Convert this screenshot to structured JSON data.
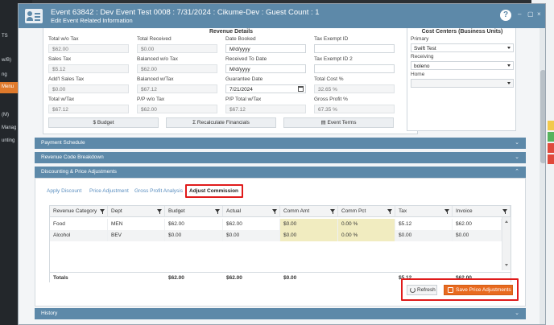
{
  "background": {
    "left_items": [
      "TS",
      "w/B)",
      "ng",
      "Menu",
      "(M)",
      "Manag",
      "unting"
    ],
    "menu_item": "Menu"
  },
  "header": {
    "title": "Event 63842 : Dev Event Test 0008 : 7/31/2024 : Cikume-Dev : Guest Count : 1",
    "subtitle": "Edit Event Related Information",
    "help_label": "?",
    "minimize": "–",
    "maximize": "▢",
    "close": "×"
  },
  "revenue": {
    "title": "Revenue Details",
    "fields": [
      {
        "label": "Total w/o Tax",
        "value": "$62.00",
        "editable": false
      },
      {
        "label": "Total Received",
        "value": "$0.00",
        "editable": false
      },
      {
        "label": "Date Booked",
        "value": "M/d/yyyy",
        "editable": true
      },
      {
        "label": "Tax Exempt ID",
        "value": "",
        "editable": true
      },
      {
        "label": "Sales Tax",
        "value": "$5.12",
        "editable": false
      },
      {
        "label": "Balanced w/o Tax",
        "value": "$62.00",
        "editable": false
      },
      {
        "label": "Received To Date",
        "value": "M/d/yyyy",
        "editable": true
      },
      {
        "label": "Tax Exempt ID 2",
        "value": "",
        "editable": true
      },
      {
        "label": "Add'l Sales Tax",
        "value": "$0.00",
        "editable": false
      },
      {
        "label": "Balanced w/Tax",
        "value": "$67.12",
        "editable": false
      },
      {
        "label": "Guarantee Date",
        "value": "7/21/2024",
        "editable": true
      },
      {
        "label": "Total Cost %",
        "value": "32.65 %",
        "editable": false
      },
      {
        "label": "Total w/Tax",
        "value": "$67.12",
        "editable": false
      },
      {
        "label": "P/P w/o Tax",
        "value": "$62.00",
        "editable": false
      },
      {
        "label": "P/P Total w/Tax",
        "value": "$67.12",
        "editable": false
      },
      {
        "label": "Gross Profit %",
        "value": "67.35 %",
        "editable": false
      }
    ],
    "buttons": {
      "budget": "$  Budget",
      "recalculate": "Σ  Recalculate Financials",
      "event_terms": "▤  Event Terms"
    }
  },
  "cost_centers": {
    "title": "Cost Centers (Business Units)",
    "primary_label": "Primary",
    "primary_value": "Swift Test",
    "receiving_label": "Receiving",
    "receiving_value": "boleno",
    "home_label": "Home",
    "home_value": ""
  },
  "sections": {
    "payment_schedule": "Payment Schedule",
    "revenue_code_breakdown": "Revenue Code Breakdown",
    "discounting": "Discounting & Price Adjustments",
    "history": "History",
    "chev_down": "⌄",
    "chev_up": "⌃"
  },
  "tabs": [
    "Apply Discount",
    "Price Adjustment",
    "Gross Profit Analysis",
    "Adjust Commission"
  ],
  "grid": {
    "headers": [
      "Revenue Category",
      "Dept",
      "Budget",
      "Actual",
      "Comm Amt",
      "Comm Pct",
      "Tax",
      "Invoice"
    ],
    "rows": [
      [
        "Food",
        "MEN",
        "$62.00",
        "$62.00",
        "$0.00",
        "0.00 %",
        "$5.12",
        "$62.00"
      ],
      [
        "Alcohol",
        "BEV",
        "$0.00",
        "$0.00",
        "$0.00",
        "0.00 %",
        "$0.00",
        "$0.00"
      ]
    ],
    "totals": {
      "label": "Totals",
      "budget": "$62.00",
      "actual": "$62.00",
      "comm_amt": "$0.00",
      "tax": "$5.12",
      "invoice": "$62.00"
    }
  },
  "actions": {
    "refresh": "Refresh",
    "save": "Save Price Adjustments"
  },
  "colors": {
    "header": "#5d89a9",
    "accent": "#e86a1f",
    "highlight": "#e01b1b",
    "commission_cell": "#f1ecc0"
  }
}
